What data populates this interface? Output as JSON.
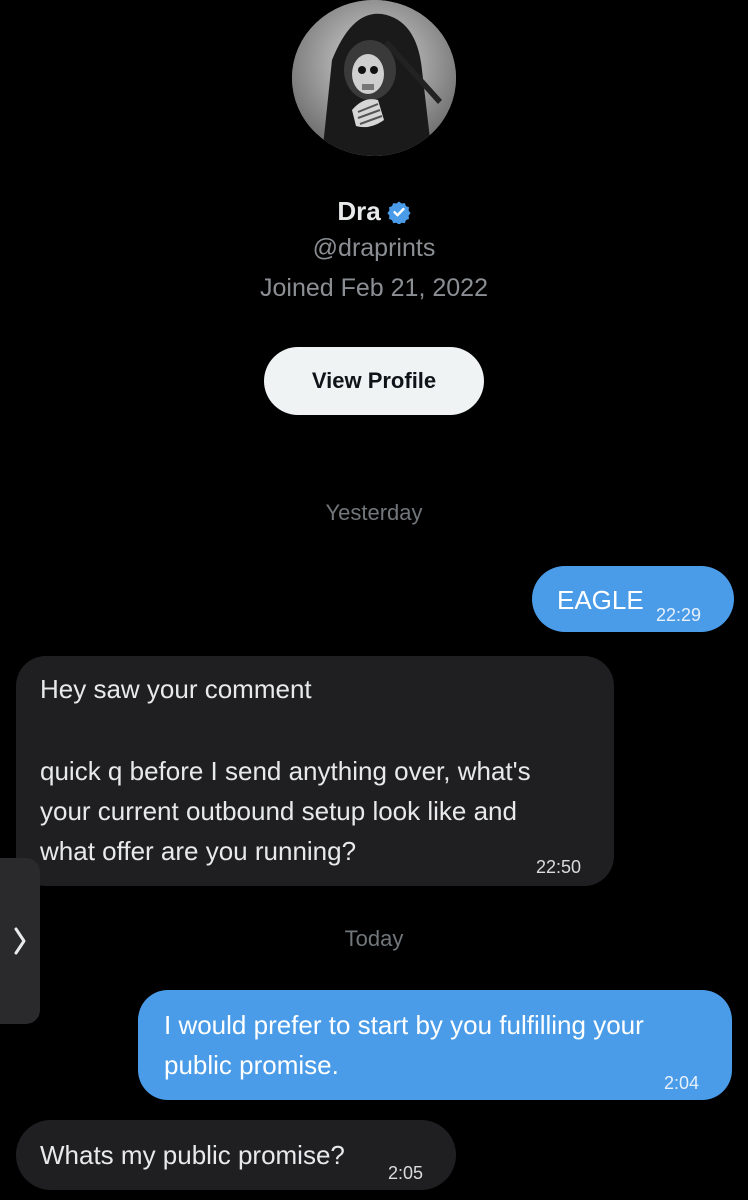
{
  "profile": {
    "name": "Dra",
    "handle": "@draprints",
    "joined": "Joined Feb 21, 2022",
    "view_profile_label": "View Profile",
    "verified_color": "#4a9ce8"
  },
  "messages": {
    "day1": "Yesterday",
    "m1": {
      "text": "EAGLE",
      "time": "22:29",
      "direction": "outgoing"
    },
    "m2": {
      "line1": "Hey saw your comment",
      "line2": "quick q before I send anything over, what's",
      "line3": "your current outbound setup look like and",
      "line4": "what offer are you running?",
      "time": "22:50",
      "direction": "incoming"
    },
    "day2": "Today",
    "m3": {
      "line1": "I would prefer to start by you fulfilling your",
      "line2": "public promise.",
      "time": "2:04",
      "direction": "outgoing"
    },
    "m4": {
      "text": "Whats my public promise?",
      "time": "2:05",
      "direction": "incoming"
    }
  },
  "icons": {
    "avatar": "avatar-skull-hood",
    "verified": "verified-badge-icon",
    "side_tab": "chevron-right-icon"
  },
  "colors": {
    "background": "#000000",
    "outgoing_bubble": "#4a9ce8",
    "incoming_bubble": "#1f1f21"
  }
}
